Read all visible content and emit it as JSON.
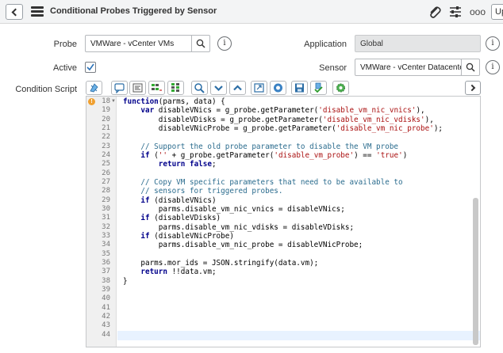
{
  "header": {
    "title": "Conditional Probes Triggered by Sensor",
    "more_label": "ooo",
    "update_label": "Up"
  },
  "form": {
    "probe_label": "Probe",
    "probe_value": "VMWare - vCenter VMs",
    "application_label": "Application",
    "application_value": "Global",
    "active_label": "Active",
    "active_checked": true,
    "sensor_label": "Sensor",
    "sensor_value": "VMWare - vCenter Datacenters",
    "condition_script_label": "Condition Script"
  },
  "toolbar": {
    "buttons": [
      "toggle-comment",
      "comment-icon",
      "format-icon",
      "replace-icon",
      "replace-all-icon",
      "search-icon",
      "toggle-down-icon",
      "toggle-up-icon",
      "fullscreen-icon",
      "help-icon",
      "save-icon",
      "script-check-icon",
      "settings-icon"
    ]
  },
  "editor": {
    "error_marker": "!",
    "lines": [
      {
        "n": "18",
        "t": "function(parms, data) {"
      },
      {
        "n": "19",
        "t": "    var disableVNics = g_probe.getParameter('disable_vm_nic_vnics'),"
      },
      {
        "n": "20",
        "t": "        disableVDisks = g_probe.getParameter('disable_vm_nic_vdisks'),"
      },
      {
        "n": "21",
        "t": "        disableVNicProbe = g_probe.getParameter('disable_vm_nic_probe');"
      },
      {
        "n": "22",
        "t": ""
      },
      {
        "n": "23",
        "t": "    // Support the old probe parameter to disable the VM probe"
      },
      {
        "n": "24",
        "t": "    if ('' + g_probe.getParameter('disable_vm_probe') == 'true')"
      },
      {
        "n": "25",
        "t": "        return false;"
      },
      {
        "n": "26",
        "t": ""
      },
      {
        "n": "27",
        "t": "    // Copy VM specific parameters that need to be available to"
      },
      {
        "n": "28",
        "t": "    // sensors for triggered probes."
      },
      {
        "n": "29",
        "t": "    if (disableVNics)"
      },
      {
        "n": "30",
        "t": "        parms.disable_vm_nic_vnics = disableVNics;"
      },
      {
        "n": "31",
        "t": "    if (disableVDisks)"
      },
      {
        "n": "32",
        "t": "        parms.disable_vm_nic_vdisks = disableVDisks;"
      },
      {
        "n": "33",
        "t": "    if (disableVNicProbe)"
      },
      {
        "n": "34",
        "t": "        parms.disable_vm_nic_probe = disableVNicProbe;"
      },
      {
        "n": "35",
        "t": ""
      },
      {
        "n": "36",
        "t": "    parms.mor_ids = JSON.stringify(data.vm);"
      },
      {
        "n": "37",
        "t": "    return !!data.vm;"
      },
      {
        "n": "38",
        "t": "}"
      },
      {
        "n": "39",
        "t": ""
      },
      {
        "n": "40",
        "t": ""
      },
      {
        "n": "41",
        "t": ""
      },
      {
        "n": "42",
        "t": ""
      },
      {
        "n": "43",
        "t": ""
      },
      {
        "n": "44",
        "t": ""
      }
    ]
  }
}
